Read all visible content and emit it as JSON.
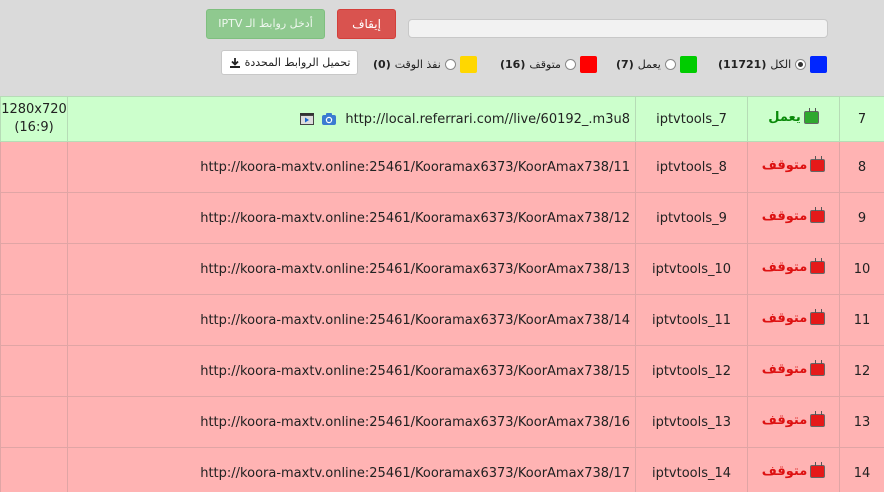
{
  "header": {
    "stop_label": "إيقاف",
    "enter_links_label": "أدخل روابط الـ IPTV",
    "download_label": "تحميل الروابط المحددة",
    "download_icon": "download-icon"
  },
  "filters": [
    {
      "label": "الكل",
      "count": "(11721)",
      "color": "#0026ff",
      "checked": true
    },
    {
      "label": "يعمل",
      "count": "(7)",
      "color": "#00cc00",
      "checked": false
    },
    {
      "label": "متوقف",
      "count": "(16)",
      "color": "#ff0000",
      "checked": false
    },
    {
      "label": "نفذ الوقت",
      "count": "(0)",
      "color": "#ffd700",
      "checked": false
    }
  ],
  "rows": [
    {
      "num": "7",
      "status": "يعمل",
      "state": "ok",
      "name": "iptvtools_7",
      "url": "http://local.referrari.com//live/60192_.m3u8",
      "res_line1": "1280x720",
      "res_line2": "(16:9)"
    },
    {
      "num": "8",
      "status": "متوقف",
      "state": "stopped",
      "name": "iptvtools_8",
      "url": "http://koora-maxtv.online:25461/Kooramax6373/KoorAmax738/11",
      "res_line1": "",
      "res_line2": ""
    },
    {
      "num": "9",
      "status": "متوقف",
      "state": "stopped",
      "name": "iptvtools_9",
      "url": "http://koora-maxtv.online:25461/Kooramax6373/KoorAmax738/12",
      "res_line1": "",
      "res_line2": ""
    },
    {
      "num": "10",
      "status": "متوقف",
      "state": "stopped",
      "name": "iptvtools_10",
      "url": "http://koora-maxtv.online:25461/Kooramax6373/KoorAmax738/13",
      "res_line1": "",
      "res_line2": ""
    },
    {
      "num": "11",
      "status": "متوقف",
      "state": "stopped",
      "name": "iptvtools_11",
      "url": "http://koora-maxtv.online:25461/Kooramax6373/KoorAmax738/14",
      "res_line1": "",
      "res_line2": ""
    },
    {
      "num": "12",
      "status": "متوقف",
      "state": "stopped",
      "name": "iptvtools_12",
      "url": "http://koora-maxtv.online:25461/Kooramax6373/KoorAmax738/15",
      "res_line1": "",
      "res_line2": ""
    },
    {
      "num": "13",
      "status": "متوقف",
      "state": "stopped",
      "name": "iptvtools_13",
      "url": "http://koora-maxtv.online:25461/Kooramax6373/KoorAmax738/16",
      "res_line1": "",
      "res_line2": ""
    },
    {
      "num": "14",
      "status": "متوقف",
      "state": "stopped",
      "name": "iptvtools_14",
      "url": "http://koora-maxtv.online:25461/Kooramax6373/KoorAmax738/17",
      "res_line1": "",
      "res_line2": ""
    }
  ],
  "row_icons": {
    "player": "video-player-icon",
    "screenshot": "camera-icon"
  }
}
